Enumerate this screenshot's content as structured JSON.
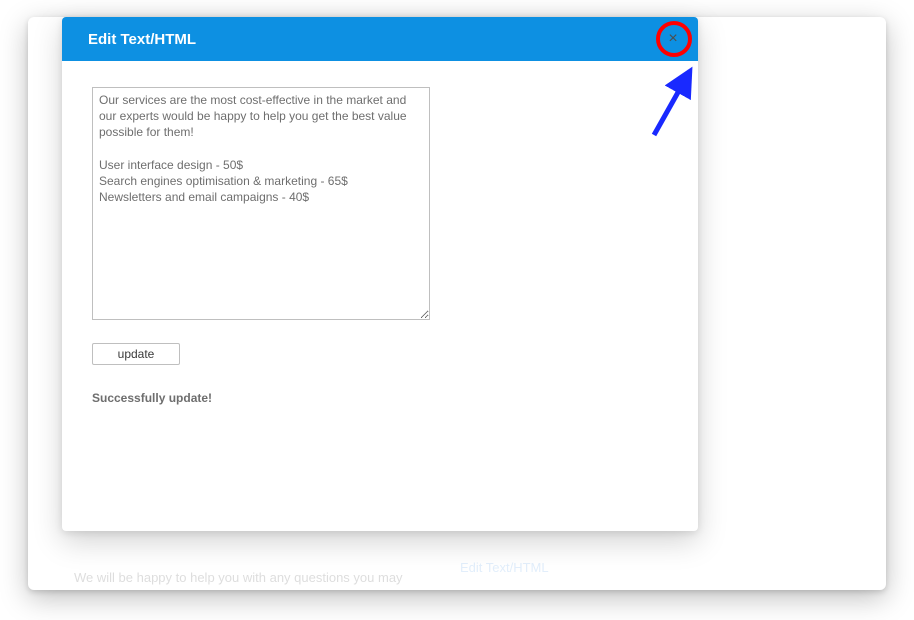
{
  "modal": {
    "title": "Edit Text/HTML",
    "close_icon": "×",
    "textarea_value": "Our services are the most cost-effective in the market and our experts would be happy to help you get the best value possible for them!\n\nUser interface design - 50$\nSearch engines optimisation & marketing - 65$\nNewsletters and email campaigns - 40$",
    "update_label": "update",
    "status_message": "Successfully update!"
  },
  "background": {
    "text_snippet": "We will be happy to help you with any questions you may",
    "link_label": "Edit Text/HTML"
  }
}
